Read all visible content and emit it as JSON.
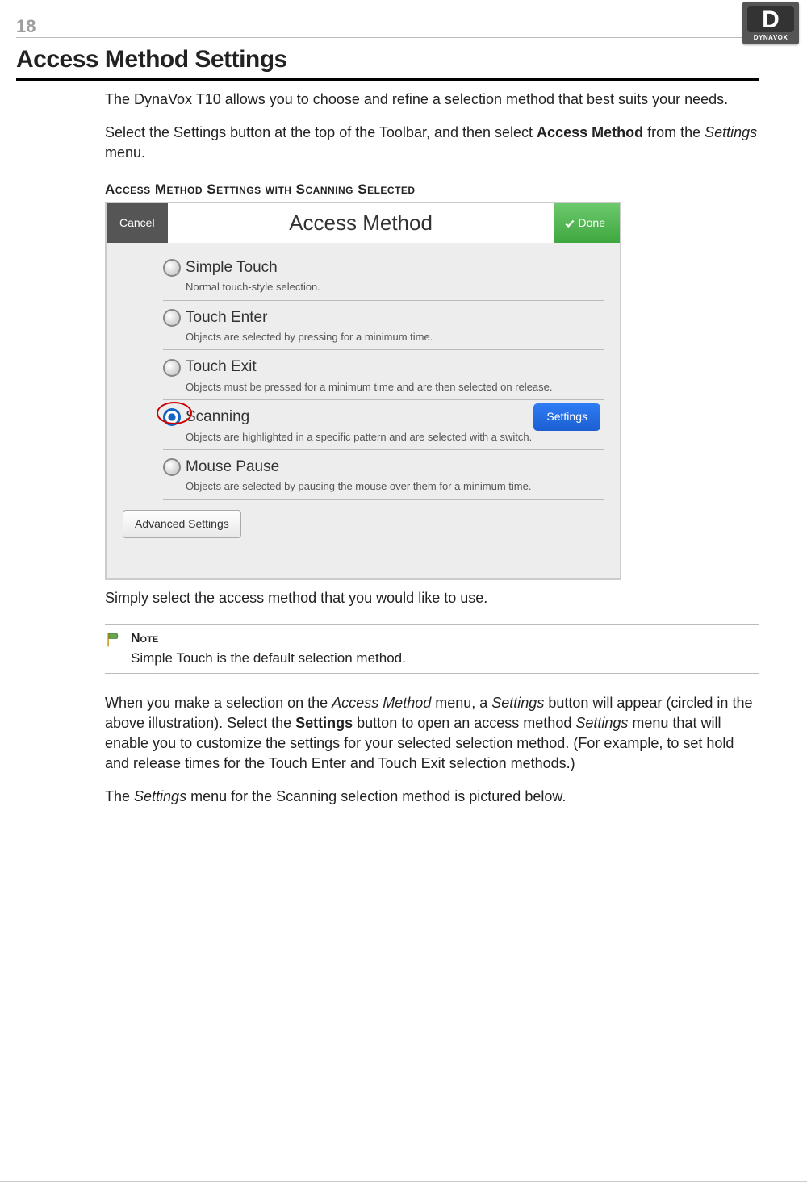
{
  "page_number": "18",
  "brand": {
    "letter": "D",
    "name": "DYNAVOX"
  },
  "section_title": "Access Method Settings",
  "intro_p1": "The DynaVox T10 allows you to choose and refine a selection method that best suits your needs.",
  "intro_p2_a": "Select the Settings button at the top of the Toolbar, and then select ",
  "intro_p2_b": "Access Method",
  "intro_p2_c": " from the ",
  "intro_p2_d": "Settings",
  "intro_p2_e": " menu.",
  "figure_caption": "Access Method Settings with Scanning Selected",
  "screenshot": {
    "cancel": "Cancel",
    "title": "Access Method",
    "done": "Done",
    "options": [
      {
        "title": "Simple Touch",
        "desc": "Normal touch-style selection.",
        "selected": false
      },
      {
        "title": "Touch Enter",
        "desc": "Objects are selected by pressing for a minimum time.",
        "selected": false
      },
      {
        "title": "Touch Exit",
        "desc": "Objects must be pressed for a minimum time and are then selected on release.",
        "selected": false
      },
      {
        "title": "Scanning",
        "desc": "Objects are highlighted in a specific pattern and are selected with a switch.",
        "selected": true
      },
      {
        "title": "Mouse Pause",
        "desc": "Objects are selected by pausing the mouse over them for a minimum time.",
        "selected": false
      }
    ],
    "settings_btn": "Settings",
    "advanced_btn": "Advanced Settings"
  },
  "after_p1": "Simply select the access method that you would like to use.",
  "note": {
    "title": "Note",
    "text": "Simple Touch is the default selection method."
  },
  "after_p2_a": "When you make a selection on the ",
  "after_p2_b": "Access Method",
  "after_p2_c": " menu, a ",
  "after_p2_d": "Settings",
  "after_p2_e": " button will appear (circled in the above illustration). Select the ",
  "after_p2_f": "Settings",
  "after_p2_g": " button to open an access method ",
  "after_p2_h": "Settings",
  "after_p2_i": " menu that will enable you to customize the settings for your selected selection method. (For example, to set hold and release times for the Touch Enter and Touch Exit selection methods.)",
  "after_p3_a": "The ",
  "after_p3_b": "Settings",
  "after_p3_c": " menu for the Scanning selection method is pictured below."
}
